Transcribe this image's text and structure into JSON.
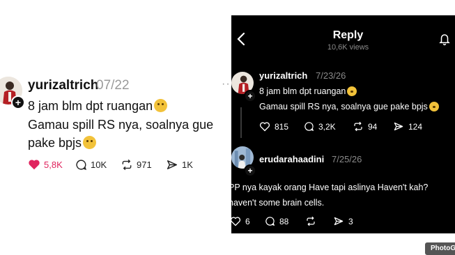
{
  "left_post": {
    "username": "yurizaltrich",
    "time": "07/22",
    "more": "···",
    "lines": [
      "8 jam blm dpt ruangan",
      "Gamau spill RS nya, soalnya gue",
      "pake bpjs"
    ],
    "likes": "5,8K",
    "comments": "10K",
    "reposts": "971",
    "shares": "1K",
    "like_color": "#e0245e"
  },
  "right_panel": {
    "title": "Reply",
    "views": "10,6K views",
    "post": {
      "username": "yurizaltrich",
      "time": "7/23/26",
      "lines": [
        "8 jam blm dpt ruangan",
        "Gamau spill RS nya, soalnya gue pake bpjs"
      ],
      "likes": "815",
      "comments": "3,2K",
      "reposts": "94",
      "shares": "124"
    },
    "reply": {
      "username": "erudarahaadini",
      "time": "7/25/26",
      "lines": [
        "PP nya kayak orang Have tapi aslinya Haven't kah?",
        "haven't some brain cells."
      ],
      "likes": "6",
      "comments": "88",
      "shares": "3"
    }
  },
  "watermark": "PhotoG",
  "icons": [
    "back-chevron-icon",
    "bell-icon",
    "heart-icon",
    "comment-icon",
    "repost-icon",
    "share-icon",
    "plus-icon"
  ]
}
